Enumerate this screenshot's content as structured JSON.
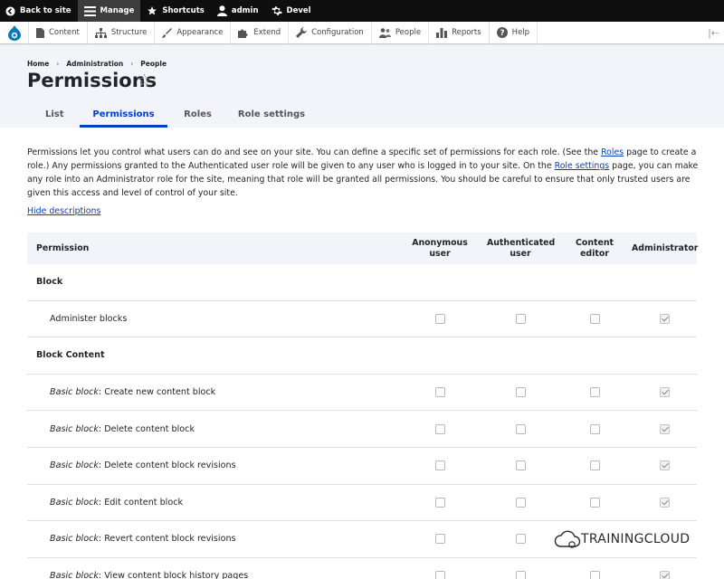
{
  "toolbar": {
    "items": [
      {
        "label": "Back to site",
        "icon": "back-circle-icon"
      },
      {
        "label": "Manage",
        "icon": "menu-icon"
      },
      {
        "label": "Shortcuts",
        "icon": "star-icon"
      },
      {
        "label": "admin",
        "icon": "person-icon"
      },
      {
        "label": "Devel",
        "icon": "gear-icon"
      }
    ]
  },
  "tray": {
    "items": [
      {
        "label": "Content",
        "icon": "file-icon"
      },
      {
        "label": "Structure",
        "icon": "sitemap-icon"
      },
      {
        "label": "Appearance",
        "icon": "brush-icon"
      },
      {
        "label": "Extend",
        "icon": "puzzle-icon"
      },
      {
        "label": "Configuration",
        "icon": "wrench-icon"
      },
      {
        "label": "People",
        "icon": "people-icon"
      },
      {
        "label": "Reports",
        "icon": "bar-chart-icon"
      },
      {
        "label": "Help",
        "icon": "help-icon"
      }
    ],
    "toggle": "|⇠"
  },
  "breadcrumb": [
    "Home",
    "Administration",
    "People"
  ],
  "breadcrumb_sep": "›",
  "page_title": "Permissions",
  "star_glyph": "☆",
  "tabs": [
    "List",
    "Permissions",
    "Roles",
    "Role settings"
  ],
  "description": {
    "p1": "Permissions let you control what users can do and see on your site. You can define a specific set of permissions for each role. (See the ",
    "roles_link": "Roles",
    "p2": " page to create a role.) Any permissions granted to the Authenticated user role will be given to any user who is logged in to your site. On the ",
    "role_settings_link": "Role settings",
    "p3": " page, you can make any role into an Administrator role for the site, meaning that role will be granted all permissions. You should be careful to ensure that only trusted users are given this access and level of control of your site."
  },
  "hide_descriptions": "Hide descriptions",
  "table": {
    "headers": {
      "permission": "Permission",
      "roles": [
        "Anonymous user",
        "Authenticated user",
        "Content editor",
        "Administrator"
      ]
    },
    "rows": [
      {
        "type": "section",
        "label": "Block"
      },
      {
        "type": "item",
        "prefix": "",
        "label": "Administer blocks",
        "checks": [
          false,
          false,
          false,
          true
        ]
      },
      {
        "type": "section",
        "label": "Block Content"
      },
      {
        "type": "item",
        "prefix": "Basic block",
        "label": ": Create new content block",
        "checks": [
          false,
          false,
          false,
          true
        ]
      },
      {
        "type": "item",
        "prefix": "Basic block",
        "label": ": Delete content block",
        "checks": [
          false,
          false,
          false,
          true
        ]
      },
      {
        "type": "item",
        "prefix": "Basic block",
        "label": ": Delete content block revisions",
        "checks": [
          false,
          false,
          false,
          true
        ]
      },
      {
        "type": "item",
        "prefix": "Basic block",
        "label": ": Edit content block",
        "checks": [
          false,
          false,
          false,
          true
        ]
      },
      {
        "type": "item",
        "prefix": "Basic block",
        "label": ": Revert content block revisions",
        "checks": [
          false,
          false,
          false,
          true
        ]
      },
      {
        "type": "item",
        "prefix": "Basic block",
        "label": ": View content block history pages",
        "checks": [
          false,
          false,
          false,
          true
        ]
      }
    ]
  },
  "watermark": {
    "text": "TRAININGCLOUD"
  },
  "colors": {
    "accent": "#003ecc",
    "toolbar": "#0f0f0f",
    "header_bg": "#f3f4f9"
  }
}
